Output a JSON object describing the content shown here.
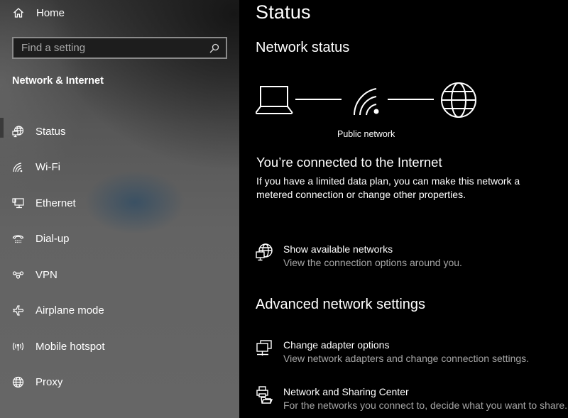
{
  "sidebar": {
    "home": {
      "label": "Home",
      "icon": "home-icon"
    },
    "search": {
      "placeholder": "Find a setting",
      "value": "",
      "icon": "search-icon"
    },
    "section_title": "Network & Internet",
    "items": [
      {
        "label": "Status",
        "icon": "status-globe-icon",
        "selected": true
      },
      {
        "label": "Wi-Fi",
        "icon": "wifi-icon",
        "selected": false
      },
      {
        "label": "Ethernet",
        "icon": "ethernet-icon",
        "selected": false
      },
      {
        "label": "Dial-up",
        "icon": "dialup-phone-icon",
        "selected": false
      },
      {
        "label": "VPN",
        "icon": "vpn-icon",
        "selected": false
      },
      {
        "label": "Airplane mode",
        "icon": "airplane-icon",
        "selected": false
      },
      {
        "label": "Mobile hotspot",
        "icon": "hotspot-icon",
        "selected": false
      },
      {
        "label": "Proxy",
        "icon": "globe-icon",
        "selected": false
      }
    ]
  },
  "main": {
    "title": "Status",
    "network_status": {
      "heading": "Network status",
      "diagram": {
        "nodes": [
          "laptop-icon",
          "wifi-icon",
          "globe-icon"
        ],
        "network_label": "Public network"
      },
      "connected_title": "You’re connected to the Internet",
      "connected_desc": "If you have a limited data plan, you can make this network a metered connection or change other properties."
    },
    "show_networks": {
      "title": "Show available networks",
      "desc": "View the connection options around you.",
      "icon": "network-globe-icon"
    },
    "advanced": {
      "heading": "Advanced network settings",
      "items": [
        {
          "title": "Change adapter options",
          "desc": "View network adapters and change connection settings.",
          "icon": "adapter-monitors-icon"
        },
        {
          "title": "Network and Sharing Center",
          "desc": "For the networks you connect to, decide what you want to share.",
          "icon": "sharing-center-icon"
        }
      ]
    }
  }
}
